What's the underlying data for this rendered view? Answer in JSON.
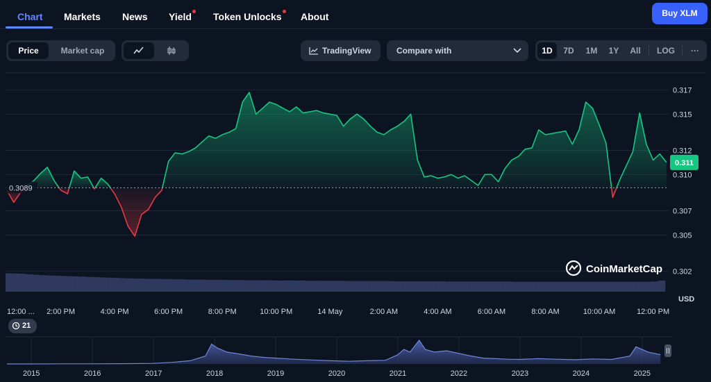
{
  "nav": {
    "tabs": [
      {
        "label": "Chart",
        "active": true
      },
      {
        "label": "Markets"
      },
      {
        "label": "News"
      },
      {
        "label": "Yield",
        "dot": true
      },
      {
        "label": "Token Unlocks",
        "dot": true
      },
      {
        "label": "About"
      }
    ],
    "buy_label": "Buy XLM"
  },
  "toolbar": {
    "price_label": "Price",
    "marketcap_label": "Market cap",
    "tradingview_label": "TradingView",
    "compare_label": "Compare with",
    "ranges": [
      "1D",
      "7D",
      "1M",
      "1Y",
      "All",
      "LOG"
    ],
    "active_range": "1D",
    "more_label": "···"
  },
  "colors": {
    "up": "#16c784",
    "down": "#ea3943",
    "accent": "#3861fb",
    "volume": "#3a4672"
  },
  "chart_data": {
    "type": "area",
    "baseline": 0.3089,
    "baseline_label": "0.3089",
    "current": 0.311,
    "current_label": "0.311",
    "ylim": [
      0.3003,
      0.3187
    ],
    "y_ticks": [
      0.302,
      0.305,
      0.307,
      0.31,
      0.312,
      0.315,
      0.317
    ],
    "y_tick_labels": [
      "0.302",
      "0.305",
      "0.307",
      "0.310",
      "0.312",
      "0.315",
      "0.317"
    ],
    "y_unit": "USD",
    "x_range": [
      0,
      24.5
    ],
    "x_ticks": [
      {
        "x": 0,
        "label": "12:00 ..."
      },
      {
        "x": 2,
        "label": "2:00 PM"
      },
      {
        "x": 4,
        "label": "4:00 PM"
      },
      {
        "x": 6,
        "label": "6:00 PM"
      },
      {
        "x": 8,
        "label": "8:00 PM"
      },
      {
        "x": 10,
        "label": "10:00 PM"
      },
      {
        "x": 12,
        "label": "14 May"
      },
      {
        "x": 14,
        "label": "2:00 AM"
      },
      {
        "x": 16,
        "label": "4:00 AM"
      },
      {
        "x": 18,
        "label": "6:00 AM"
      },
      {
        "x": 20,
        "label": "8:00 AM"
      },
      {
        "x": 22,
        "label": "10:00 AM"
      },
      {
        "x": 24,
        "label": "12:00 PM"
      }
    ],
    "x": [
      0,
      0.25,
      0.5,
      0.75,
      1,
      1.25,
      1.5,
      1.75,
      2,
      2.25,
      2.5,
      2.75,
      3,
      3.25,
      3.5,
      3.75,
      4,
      4.25,
      4.5,
      4.75,
      5,
      5.25,
      5.5,
      5.75,
      6,
      6.25,
      6.5,
      6.75,
      7,
      7.25,
      7.5,
      7.75,
      8,
      8.25,
      8.5,
      8.75,
      9,
      9.25,
      9.5,
      9.75,
      10,
      10.25,
      10.5,
      10.75,
      11,
      11.25,
      11.5,
      11.75,
      12,
      12.25,
      12.5,
      12.75,
      13,
      13.25,
      13.5,
      13.75,
      14,
      14.25,
      14.5,
      14.75,
      15,
      15.25,
      15.5,
      15.75,
      16,
      16.25,
      16.5,
      16.75,
      17,
      17.25,
      17.5,
      17.75,
      18,
      18.25,
      18.5,
      18.75,
      19,
      19.25,
      19.5,
      19.75,
      20,
      20.25,
      20.5,
      20.75,
      21,
      21.25,
      21.5,
      21.75,
      22,
      22.25,
      22.5,
      22.75,
      23,
      23.25,
      23.5,
      23.75,
      24,
      24.25,
      24.5
    ],
    "price": [
      0.3087,
      0.3077,
      0.3085,
      0.3091,
      0.3095,
      0.3101,
      0.3106,
      0.3095,
      0.3087,
      0.3084,
      0.3103,
      0.3097,
      0.3098,
      0.3088,
      0.3097,
      0.3092,
      0.3084,
      0.3073,
      0.3057,
      0.3049,
      0.3067,
      0.3071,
      0.3081,
      0.3087,
      0.3111,
      0.3118,
      0.3117,
      0.3119,
      0.3122,
      0.3127,
      0.3132,
      0.313,
      0.3133,
      0.3135,
      0.3138,
      0.316,
      0.3168,
      0.315,
      0.3155,
      0.316,
      0.3158,
      0.3155,
      0.3152,
      0.3156,
      0.3151,
      0.3152,
      0.3153,
      0.3151,
      0.315,
      0.3149,
      0.314,
      0.3146,
      0.315,
      0.3146,
      0.314,
      0.3135,
      0.3133,
      0.3137,
      0.314,
      0.3144,
      0.315,
      0.3112,
      0.3098,
      0.3099,
      0.3097,
      0.3098,
      0.31,
      0.3097,
      0.3099,
      0.3095,
      0.3091,
      0.31,
      0.31,
      0.3094,
      0.3105,
      0.3112,
      0.3115,
      0.3121,
      0.3122,
      0.3137,
      0.3133,
      0.3134,
      0.3135,
      0.3136,
      0.3125,
      0.3137,
      0.316,
      0.3155,
      0.3141,
      0.3126,
      0.3081,
      0.3095,
      0.3107,
      0.3119,
      0.3151,
      0.3125,
      0.3112,
      0.3117,
      0.311
    ],
    "volume": [
      0.76,
      0.75,
      0.74,
      0.72,
      0.7,
      0.68,
      0.67,
      0.66,
      0.65,
      0.64,
      0.63,
      0.62,
      0.61,
      0.6,
      0.59,
      0.58,
      0.57,
      0.56,
      0.55,
      0.54,
      0.54,
      0.53,
      0.53,
      0.52,
      0.52,
      0.51,
      0.51,
      0.5,
      0.5,
      0.5,
      0.49,
      0.49,
      0.49,
      0.48,
      0.48,
      0.48,
      0.47,
      0.47,
      0.47,
      0.47,
      0.46,
      0.46,
      0.46,
      0.46,
      0.46,
      0.45,
      0.45,
      0.45,
      0.45,
      0.45,
      0.45,
      0.44,
      0.44,
      0.44,
      0.44,
      0.44,
      0.44,
      0.44,
      0.43,
      0.43,
      0.43,
      0.43,
      0.43,
      0.43,
      0.43,
      0.43,
      0.42,
      0.42,
      0.42,
      0.42,
      0.42,
      0.42,
      0.42,
      0.42,
      0.42,
      0.42,
      0.41,
      0.41,
      0.41,
      0.41,
      0.41,
      0.41,
      0.41,
      0.41,
      0.41,
      0.41,
      0.41,
      0.41,
      0.41,
      0.41,
      0.41,
      0.41,
      0.41,
      0.41,
      0.41,
      0.41,
      0.41,
      0.42,
      0.46
    ],
    "navigator": {
      "x_range": [
        2014.6,
        2025.4
      ],
      "year_labels": [
        "2015",
        "2016",
        "2017",
        "2018",
        "2019",
        "2020",
        "2021",
        "2022",
        "2023",
        "2024",
        "2025"
      ],
      "years": [
        2015,
        2016,
        2017,
        2018,
        2019,
        2020,
        2021,
        2022,
        2023,
        2024,
        2025
      ],
      "x": [
        2014.6,
        2015.0,
        2015.5,
        2016.0,
        2016.5,
        2017.0,
        2017.3,
        2017.6,
        2017.85,
        2017.95,
        2018.05,
        2018.2,
        2018.4,
        2018.6,
        2018.8,
        2019.0,
        2019.3,
        2019.6,
        2019.9,
        2020.2,
        2020.5,
        2020.8,
        2021.0,
        2021.1,
        2021.2,
        2021.3,
        2021.35,
        2021.45,
        2021.6,
        2021.8,
        2022.0,
        2022.2,
        2022.4,
        2022.6,
        2022.8,
        2023.0,
        2023.3,
        2023.6,
        2023.9,
        2024.2,
        2024.5,
        2024.8,
        2024.9,
        2025.0,
        2025.1,
        2025.3
      ],
      "values": [
        0.0,
        0.0,
        0.005,
        0.005,
        0.01,
        0.02,
        0.06,
        0.12,
        0.3,
        0.75,
        0.6,
        0.45,
        0.38,
        0.3,
        0.25,
        0.22,
        0.18,
        0.15,
        0.12,
        0.1,
        0.12,
        0.14,
        0.35,
        0.55,
        0.45,
        0.75,
        0.9,
        0.55,
        0.45,
        0.5,
        0.4,
        0.3,
        0.22,
        0.2,
        0.18,
        0.17,
        0.2,
        0.18,
        0.16,
        0.19,
        0.17,
        0.3,
        0.65,
        0.55,
        0.45,
        0.35
      ]
    }
  },
  "watermark": "CoinMarketCap",
  "history_badge": "21"
}
